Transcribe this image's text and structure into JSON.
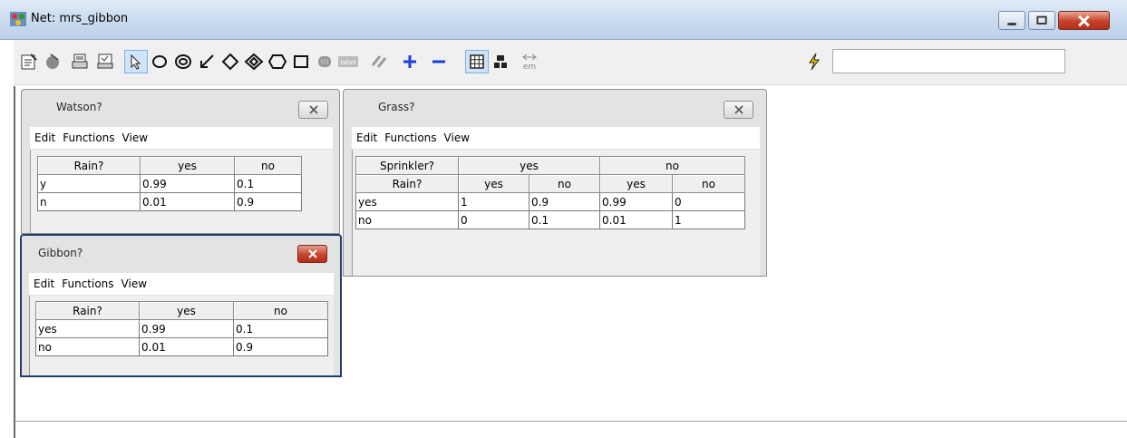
{
  "window": {
    "title": "Net: mrs_gibbon",
    "icon": "network-app-icon"
  },
  "toolbar": {
    "icons": [
      "properties-icon",
      "compile-icon",
      "print-icon",
      "print-preview-icon",
      "select-arrow-icon",
      "chance-node-icon",
      "decision-node-icon",
      "arc-icon",
      "utility-node-icon",
      "noisy-node-icon",
      "node-icon",
      "rect-node-icon",
      "submodel-icon",
      "label-icon",
      "link-icon",
      "zoom-in-icon",
      "zoom-out-icon",
      "grid-icon",
      "layout-icon",
      "em-icon",
      "lightning-icon"
    ],
    "label_icon_text": "label",
    "em_text": "em",
    "search_value": "",
    "colors": {
      "blue_accent": "#1c3fd6",
      "lightning": "#e0b000"
    }
  },
  "panels": {
    "watson": {
      "title": "Watson?",
      "menu": [
        "Edit",
        "Functions",
        "View"
      ],
      "header": [
        "Rain?",
        "yes",
        "no"
      ],
      "rows": [
        [
          "y",
          "0.99",
          "0.1"
        ],
        [
          "n",
          "0.01",
          "0.9"
        ]
      ]
    },
    "gibbon": {
      "title": "Gibbon?",
      "menu": [
        "Edit",
        "Functions",
        "View"
      ],
      "header": [
        "Rain?",
        "yes",
        "no"
      ],
      "rows": [
        [
          "yes",
          "0.99",
          "0.1"
        ],
        [
          "no",
          "0.01",
          "0.9"
        ]
      ]
    },
    "grass": {
      "title": "Grass?",
      "menu": [
        "Edit",
        "Functions",
        "View"
      ],
      "header1": [
        "Sprinkler?",
        "yes",
        "no"
      ],
      "header2": [
        "Rain?",
        "yes",
        "no",
        "yes",
        "no"
      ],
      "rows": [
        [
          "yes",
          "1",
          "0.9",
          "0.99",
          "0"
        ],
        [
          "no",
          "0",
          "0.1",
          "0.01",
          "1"
        ]
      ]
    }
  }
}
